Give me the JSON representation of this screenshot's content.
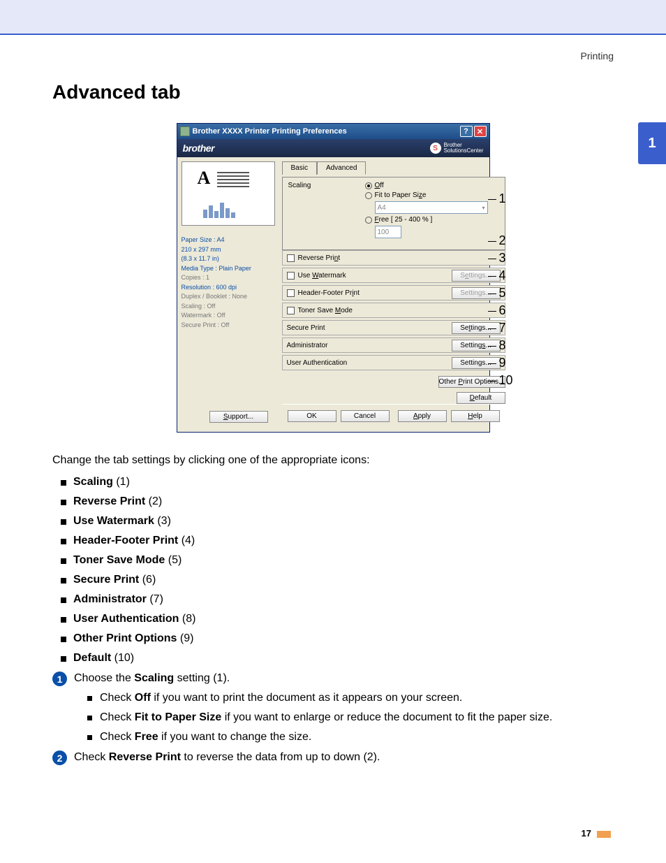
{
  "header": {
    "section": "Printing",
    "sidetab": "1",
    "title": "Advanced tab",
    "pagenum": "17"
  },
  "dialog": {
    "title": "Brother XXXX   Printer Printing Preferences",
    "brand": "brother",
    "solutions_l1": "Brother",
    "solutions_l2": "SolutionsCenter",
    "side": {
      "paper": "Paper Size : A4",
      "dim1": "210 x 297 mm",
      "dim2": "(8.3 x 11.7 in)",
      "media": "Media Type : Plain Paper",
      "copies": "Copies : 1",
      "res": "Resolution : 600 dpi",
      "duplex": "Duplex / Booklet : None",
      "scaling": "Scaling : Off",
      "wm": "Watermark : Off",
      "secure": "Secure Print : Off"
    },
    "tabs": {
      "basic": "Basic",
      "advanced": "Advanced"
    },
    "scaling": {
      "label": "Scaling",
      "off": "Off",
      "fit": "Fit to Paper Size",
      "fitval": "A4",
      "free": "Free [ 25 - 400 % ]",
      "freeval": "100"
    },
    "rows": {
      "reverse": "Reverse Print",
      "watermark": "Use Watermark",
      "hf": "Header-Footer Print",
      "toner": "Toner Save Mode",
      "secure": "Secure Print",
      "admin": "Administrator",
      "userauth": "User Authentication",
      "settings": "Settings...",
      "other": "Other Print Options...",
      "default": "Default"
    },
    "btns": {
      "support": "Support...",
      "ok": "OK",
      "cancel": "Cancel",
      "apply": "Apply",
      "help": "Help"
    }
  },
  "annots": {
    "n1": "1",
    "n2": "2",
    "n3": "3",
    "n4": "4",
    "n5": "5",
    "n6": "6",
    "n7": "7",
    "n8": "8",
    "n9": "9",
    "n10": "10"
  },
  "intro": "Change the tab settings by clicking one of the appropriate icons:",
  "list": {
    "i1b": "Scaling",
    "i1": " (1)",
    "i2b": "Reverse Print",
    "i2": " (2)",
    "i3b": "Use Watermark",
    "i3": " (3)",
    "i4b": "Header-Footer Print",
    "i4": " (4)",
    "i5b": "Toner Save Mode",
    "i5": " (5)",
    "i6b": "Secure Print",
    "i6": " (6)",
    "i7b": "Administrator",
    "i7": " (7)",
    "i8b": "User Authentication",
    "i8": " (8)",
    "i9b": "Other Print Options",
    "i9": " (9)",
    "i10b": "Default",
    "i10": " (10)"
  },
  "step1": {
    "num": "1",
    "pre": "Choose the ",
    "b": "Scaling",
    "post": " setting (1)."
  },
  "step1sub": {
    "a_pre": "Check ",
    "a_b": "Off",
    "a_post": " if you want to print the document as it appears on your screen.",
    "b_pre": "Check ",
    "b_b": "Fit to Paper Size",
    "b_post": " if you want to enlarge or reduce the document to fit the paper size.",
    "c_pre": "Check ",
    "c_b": "Free",
    "c_post": " if you want to change the size."
  },
  "step2": {
    "num": "2",
    "pre": "Check ",
    "b": "Reverse Print",
    "post": " to reverse the data from up to down (2)."
  }
}
